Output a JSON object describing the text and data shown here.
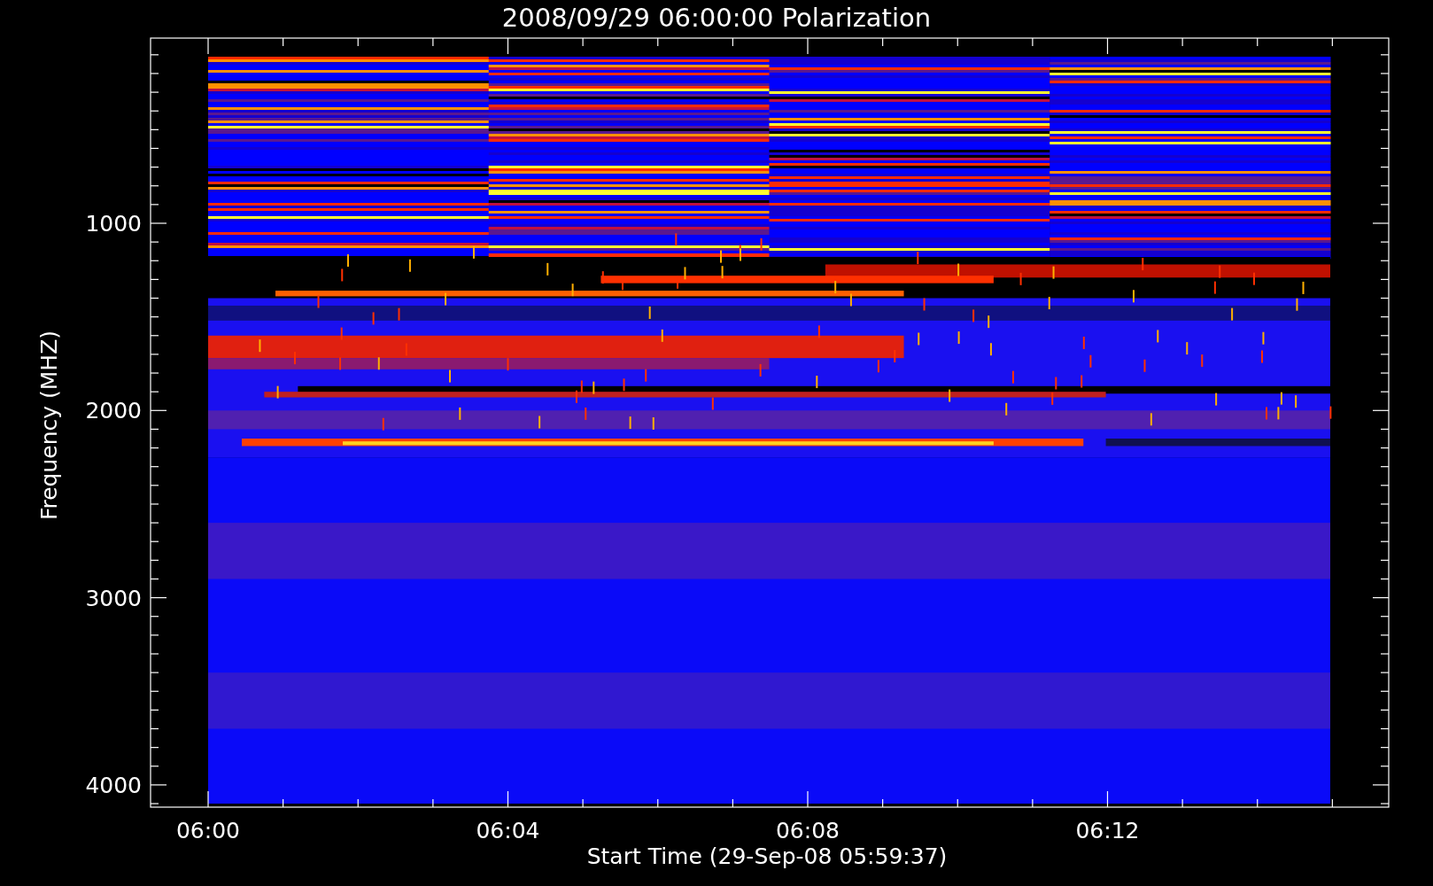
{
  "title": "2008/09/29 06:00:00 Polarization",
  "chart": {
    "xlabel": "Start Time (29-Sep-08 05:59:37)",
    "ylabel": "Frequency (MHZ)",
    "xticks": [
      "06:00",
      "06:04",
      "06:08",
      "06:12"
    ],
    "yticks": [
      "1000",
      "2000",
      "3000",
      "4000"
    ]
  }
}
